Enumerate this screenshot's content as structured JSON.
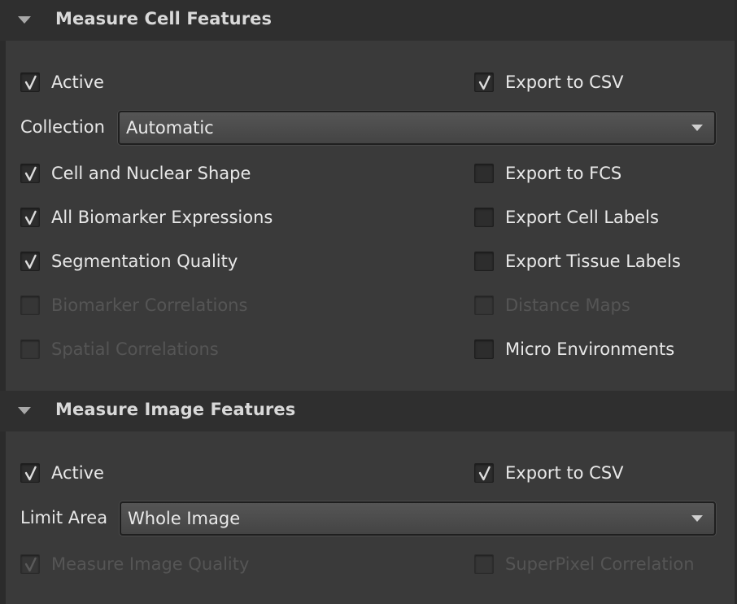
{
  "cell_section": {
    "title": "Measure Cell Features",
    "active": {
      "label": "Active",
      "checked": true,
      "disabled": false
    },
    "export_csv": {
      "label": "Export to CSV",
      "checked": true,
      "disabled": false
    },
    "collection": {
      "label": "Collection",
      "value": "Automatic"
    },
    "options_left": [
      {
        "label": "Cell and Nuclear Shape",
        "checked": true,
        "disabled": false
      },
      {
        "label": "All Biomarker Expressions",
        "checked": true,
        "disabled": false
      },
      {
        "label": "Segmentation Quality",
        "checked": true,
        "disabled": false
      },
      {
        "label": "Biomarker Correlations",
        "checked": false,
        "disabled": true
      },
      {
        "label": "Spatial Correlations",
        "checked": false,
        "disabled": true
      }
    ],
    "options_right": [
      {
        "label": "Export to FCS",
        "checked": false,
        "disabled": false
      },
      {
        "label": "Export Cell Labels",
        "checked": false,
        "disabled": false
      },
      {
        "label": "Export Tissue Labels",
        "checked": false,
        "disabled": false
      },
      {
        "label": "Distance Maps",
        "checked": false,
        "disabled": true
      },
      {
        "label": "Micro Environments",
        "checked": false,
        "disabled": false
      }
    ]
  },
  "image_section": {
    "title": "Measure Image Features",
    "active": {
      "label": "Active",
      "checked": true,
      "disabled": false
    },
    "export_csv": {
      "label": "Export to CSV",
      "checked": true,
      "disabled": false
    },
    "limit_area": {
      "label": "Limit Area",
      "value": "Whole Image"
    },
    "measure_quality": {
      "label": "Measure Image Quality",
      "checked": true,
      "disabled": true
    },
    "superpixel": {
      "label": "SuperPixel Correlation",
      "checked": false,
      "disabled": true
    }
  },
  "icons": {
    "section_toggle": "triangle-down-icon",
    "dropdown_arrow": "chevron-down-icon",
    "check": "checkmark-icon"
  },
  "colors": {
    "background": "#2b2b2b",
    "panel": "#3a3a3a",
    "header": "#2f2f2f",
    "text": "#e8e8e8",
    "disabled_text": "#555555"
  }
}
